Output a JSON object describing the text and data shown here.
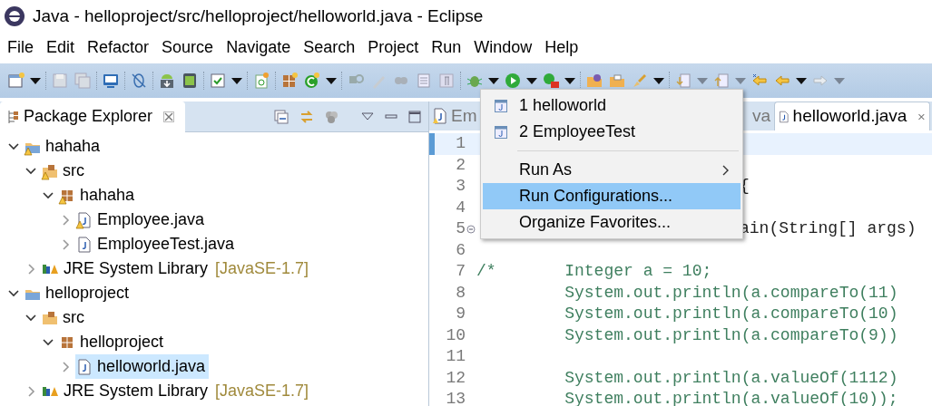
{
  "window": {
    "title": "Java - helloproject/src/helloproject/helloworld.java - Eclipse"
  },
  "menu_bar": [
    "File",
    "Edit",
    "Refactor",
    "Source",
    "Navigate",
    "Search",
    "Project",
    "Run",
    "Window",
    "Help"
  ],
  "package_explorer": {
    "title": "Package Explorer",
    "tree": [
      {
        "label": "hahaha",
        "kind": "project",
        "warning": true,
        "expanded": true,
        "selected": false,
        "children": [
          {
            "label": "src",
            "kind": "source_folder",
            "warning": true,
            "expanded": true,
            "selected": false,
            "children": [
              {
                "label": "hahaha",
                "kind": "package",
                "warning": true,
                "expanded": true,
                "selected": false,
                "children": [
                  {
                    "label": "Employee.java",
                    "kind": "java_file",
                    "warning": true,
                    "expanded": false,
                    "selected": false
                  },
                  {
                    "label": "EmployeeTest.java",
                    "kind": "java_file",
                    "warning": false,
                    "expanded": false,
                    "selected": false
                  }
                ]
              }
            ]
          },
          {
            "label": "JRE System Library",
            "suffix": "[JavaSE-1.7]",
            "kind": "library",
            "warning": false,
            "expanded": false,
            "selected": false
          }
        ]
      },
      {
        "label": "helloproject",
        "kind": "project",
        "warning": false,
        "expanded": true,
        "selected": false,
        "children": [
          {
            "label": "src",
            "kind": "source_folder",
            "warning": false,
            "expanded": true,
            "selected": false,
            "children": [
              {
                "label": "helloproject",
                "kind": "package",
                "warning": false,
                "expanded": true,
                "selected": false,
                "children": [
                  {
                    "label": "helloworld.java",
                    "kind": "java_file",
                    "warning": false,
                    "expanded": false,
                    "selected": true
                  }
                ]
              }
            ]
          },
          {
            "label": "JRE System Library",
            "suffix": "[JavaSE-1.7]",
            "kind": "library",
            "warning": false,
            "expanded": false,
            "selected": false
          }
        ]
      }
    ]
  },
  "editor": {
    "tabs": [
      {
        "label": "Em",
        "selected": false,
        "warning": true
      },
      {
        "label": "va",
        "selected": false
      },
      {
        "label": "helloworld.java",
        "selected": true,
        "warning": false
      }
    ],
    "lines": [
      {
        "number": "1",
        "current": true
      },
      {
        "number": "2",
        "current": false
      },
      {
        "number": "3",
        "text": "{",
        "current": false,
        "covered": true
      },
      {
        "number": "4",
        "current": false
      },
      {
        "number": "5",
        "text": "ain(String[] args)",
        "current": false,
        "covered": true,
        "fold": true
      },
      {
        "number": "6",
        "current": false
      },
      {
        "number": "7",
        "text": "/*       Integer a = 10;",
        "current": false,
        "covered": false
      },
      {
        "number": "8",
        "text": "         System.out.println(a.compareTo(11)",
        "current": false,
        "covered": false
      },
      {
        "number": "9",
        "text": "         System.out.println(a.compareTo(10)",
        "current": false,
        "covered": false
      },
      {
        "number": "10",
        "text": "         System.out.println(a.compareTo(9))",
        "current": false,
        "covered": false
      },
      {
        "number": "11",
        "current": false
      },
      {
        "number": "12",
        "text": "         System.out.println(a.valueOf(1112)",
        "current": false,
        "covered": false
      },
      {
        "number": "13",
        "text": "         System.out.println(a.valueOf(10));",
        "current": false,
        "covered": false
      }
    ]
  },
  "run_menu": {
    "items": [
      {
        "kind": "launch",
        "label": "1 helloworld",
        "selected": false
      },
      {
        "kind": "launch",
        "label": "2 EmployeeTest",
        "selected": false
      },
      {
        "kind": "separator"
      },
      {
        "kind": "item",
        "label": "Run As",
        "submenu": true,
        "selected": false
      },
      {
        "kind": "item",
        "label": "Run Configurations...",
        "submenu": false,
        "selected": true
      },
      {
        "kind": "item",
        "label": "Organize Favorites...",
        "submenu": false,
        "selected": false
      }
    ]
  }
}
